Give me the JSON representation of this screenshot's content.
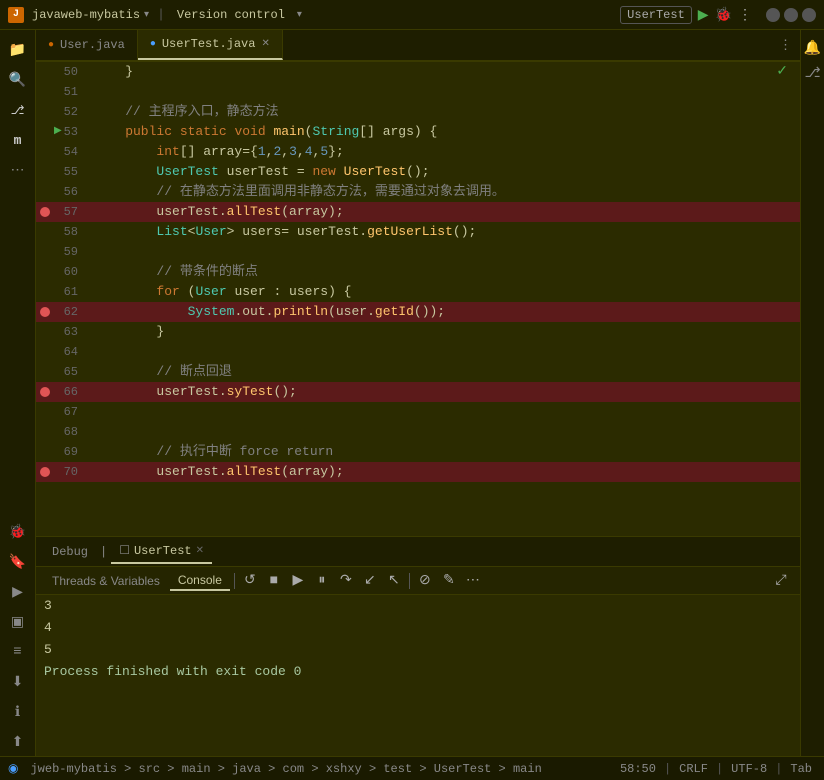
{
  "titlebar": {
    "icon_label": "J",
    "project": "javaweb-mybatis",
    "vcs": "Version control",
    "run_label": "UserTest",
    "window_btns": [
      "minimize",
      "maximize",
      "close"
    ]
  },
  "tabs": [
    {
      "id": "user",
      "label": "User.java",
      "icon": "java",
      "active": false
    },
    {
      "id": "usertest",
      "label": "UserTest.java",
      "icon": "test",
      "active": true
    }
  ],
  "lines": [
    {
      "num": "50",
      "content": "    }",
      "breakpoint": false,
      "running": false,
      "bg": "normal"
    },
    {
      "num": "51",
      "content": "",
      "breakpoint": false,
      "running": false,
      "bg": "normal"
    },
    {
      "num": "52",
      "content": "    // 主程序入口，静态方法",
      "breakpoint": false,
      "running": false,
      "bg": "normal"
    },
    {
      "num": "53",
      "content": "    public static void main(String[] args) {",
      "breakpoint": false,
      "running": true,
      "bg": "normal"
    },
    {
      "num": "54",
      "content": "        int[] array={1,2,3,4,5};",
      "breakpoint": false,
      "running": false,
      "bg": "normal"
    },
    {
      "num": "55",
      "content": "        UserTest userTest = new UserTest();",
      "breakpoint": false,
      "running": false,
      "bg": "normal"
    },
    {
      "num": "56",
      "content": "        // 在静态方法里面调用非静态方法，需要通过对象去调用。",
      "breakpoint": false,
      "running": false,
      "bg": "normal"
    },
    {
      "num": "57",
      "content": "        userTest.allTest(array);",
      "breakpoint": true,
      "running": false,
      "bg": "breakpoint"
    },
    {
      "num": "58",
      "content": "        List<User> users= userTest.getUserList();",
      "breakpoint": false,
      "running": false,
      "bg": "normal"
    },
    {
      "num": "59",
      "content": "",
      "breakpoint": false,
      "running": false,
      "bg": "normal"
    },
    {
      "num": "60",
      "content": "        // 带条件的断点",
      "breakpoint": false,
      "running": false,
      "bg": "normal"
    },
    {
      "num": "61",
      "content": "        for (User user : users) {",
      "breakpoint": false,
      "running": false,
      "bg": "normal"
    },
    {
      "num": "62",
      "content": "            System.out.println(user.getId());",
      "breakpoint": true,
      "running": false,
      "bg": "breakpoint"
    },
    {
      "num": "63",
      "content": "        }",
      "breakpoint": false,
      "running": false,
      "bg": "normal"
    },
    {
      "num": "64",
      "content": "",
      "breakpoint": false,
      "running": false,
      "bg": "normal"
    },
    {
      "num": "65",
      "content": "        // 断点回退",
      "breakpoint": false,
      "running": false,
      "bg": "normal"
    },
    {
      "num": "66",
      "content": "        userTest.syTest();",
      "breakpoint": true,
      "running": false,
      "bg": "breakpoint"
    },
    {
      "num": "67",
      "content": "",
      "breakpoint": false,
      "running": false,
      "bg": "normal"
    },
    {
      "num": "68",
      "content": "",
      "breakpoint": false,
      "running": false,
      "bg": "normal"
    },
    {
      "num": "69",
      "content": "        // 执行中断 force return",
      "breakpoint": false,
      "running": false,
      "bg": "normal"
    },
    {
      "num": "70",
      "content": "        userTest.allTest(array);",
      "breakpoint": true,
      "running": false,
      "bg": "breakpoint"
    }
  ],
  "debug": {
    "session_tab": "Debug",
    "run_tab": "UserTest",
    "tabs": [
      {
        "id": "threads",
        "label": "Threads & Variables",
        "active": false
      },
      {
        "id": "console",
        "label": "Console",
        "active": true
      }
    ],
    "toolbar_icons": [
      {
        "name": "restore",
        "symbol": "↺"
      },
      {
        "name": "stop",
        "symbol": "■"
      },
      {
        "name": "resume",
        "symbol": "▶"
      },
      {
        "name": "pause",
        "symbol": "⏸"
      },
      {
        "name": "step-over",
        "symbol": "↷"
      },
      {
        "name": "step-into",
        "symbol": "↓"
      },
      {
        "name": "step-out",
        "symbol": "↑"
      },
      {
        "name": "mute",
        "symbol": "⊘"
      },
      {
        "name": "edit",
        "symbol": "✎"
      },
      {
        "name": "more",
        "symbol": "⋯"
      }
    ],
    "console_lines": [
      "3",
      "4",
      "5"
    ],
    "process_line": "Process finished with exit code 0"
  },
  "statusbar": {
    "breadcrumb": "jweb-mybatis > src > main > java > com > xshxy > test > UserTest > main",
    "position": "58:50",
    "crlf": "CRLF",
    "encoding": "UTF-8",
    "indent": "Tab"
  }
}
